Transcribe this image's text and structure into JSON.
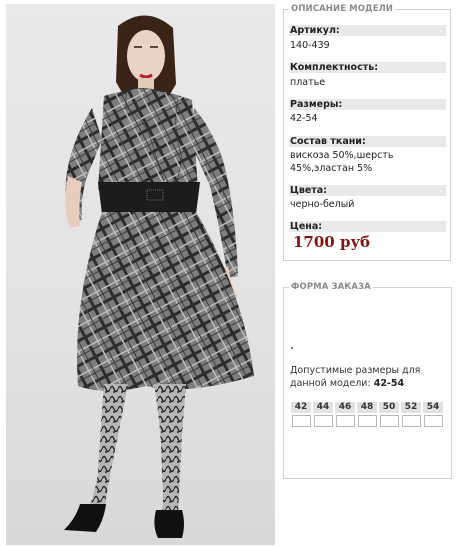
{
  "description": {
    "legend": "ОПИСАНИЕ МОДЕЛИ",
    "article_label": "Артикул:",
    "article_value": "140-439",
    "set_label": "Комплектность:",
    "set_value": "платье",
    "sizes_label": "Размеры:",
    "sizes_value": "42-54",
    "fabric_label": "Состав ткани:",
    "fabric_value": "вискоза 50%,шерсть 45%,эластан 5%",
    "colors_label": "Цвета:",
    "colors_value": "черно-белый",
    "price_label": "Цена:",
    "price_value": "1700 руб"
  },
  "order": {
    "legend": "ФОРМА ЗАКАЗА",
    "allowed_text": "Допустимые размеры для данной модели:",
    "allowed_value": "42-54",
    "sizes": [
      "42",
      "44",
      "46",
      "48",
      "50",
      "52",
      "54"
    ]
  },
  "colors": {
    "price": "#8a1111",
    "label_bg": "#e9e9e9",
    "border": "#d0d0d0"
  }
}
